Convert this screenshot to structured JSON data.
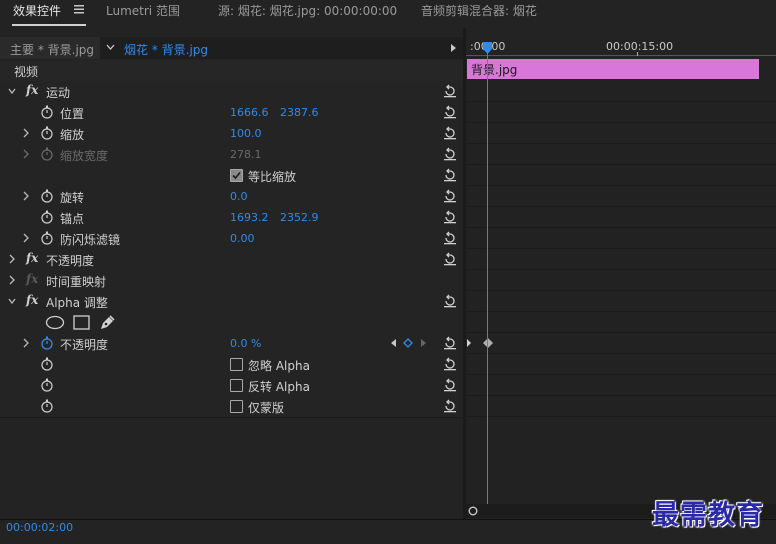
{
  "tabs": {
    "effect_controls": "效果控件",
    "lumetri": "Lumetri 范围",
    "source": "源: 烟花: 烟花.jpg: 00:00:00:00",
    "audio_mixer": "音频剪辑混合器: 烟花"
  },
  "clip_selector": {
    "master": "主要 * 背景.jpg",
    "current": "烟花 * 背景.jpg"
  },
  "section_video": "视频",
  "motion": {
    "label": "运动",
    "position_label": "位置",
    "position_x": "1666.6",
    "position_y": "2387.6",
    "scale_label": "缩放",
    "scale_value": "100.0",
    "scale_width_label": "缩放宽度",
    "scale_width_value": "278.1",
    "uniform_scale_label": "等比缩放",
    "rotation_label": "旋转",
    "rotation_value": "0.0",
    "anchor_label": "锚点",
    "anchor_x": "1693.2",
    "anchor_y": "2352.9",
    "antiflicker_label": "防闪烁滤镜",
    "antiflicker_value": "0.00"
  },
  "opacity": {
    "label": "不透明度"
  },
  "time_remap": {
    "label": "时间重映射"
  },
  "alpha_adjust": {
    "label": "Alpha 调整",
    "opacity_label": "不透明度",
    "opacity_value": "0.0 %",
    "ignore_alpha": "忽略 Alpha",
    "invert_alpha": "反转 Alpha",
    "mask_only": "仅蒙版"
  },
  "timeline": {
    "tick_start": ":00:00",
    "tick_15": "00:00:15:00",
    "clip_name": "背景.jpg"
  },
  "status": {
    "timecode": "00:00:02:00"
  },
  "watermark": "最需教育",
  "colors": {
    "accent_blue": "#2d8ceb",
    "clip_pink": "#d977d9",
    "panel_bg": "#232323"
  }
}
